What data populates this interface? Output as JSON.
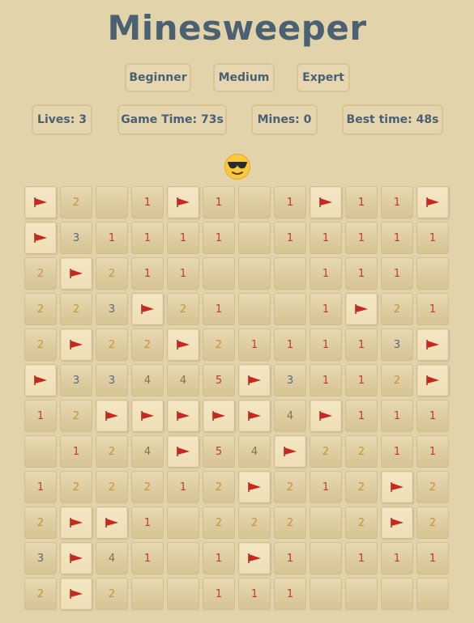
{
  "title": "Minesweeper",
  "difficulty": {
    "beginner": "Beginner",
    "medium": "Medium",
    "expert": "Expert"
  },
  "stats": {
    "lives": "Lives: 3",
    "game_time": "Game Time: 73s",
    "mines": "Mines: 0",
    "best_time": "Best time: 48s"
  },
  "face_icon": "sunglasses-face-icon",
  "colors": {
    "background": "#e3d3aa",
    "title": "#4a6173",
    "flag": "#c5281c"
  },
  "board": [
    [
      "F",
      "2",
      "",
      "1",
      "F",
      "1",
      "",
      "1",
      "F",
      "1",
      "1",
      "F"
    ],
    [
      "F",
      "3",
      "1",
      "1",
      "1",
      "1",
      "",
      "1",
      "1",
      "1",
      "1",
      "1"
    ],
    [
      "2",
      "F",
      "2",
      "1",
      "1",
      "",
      "",
      "",
      "1",
      "1",
      "1",
      ""
    ],
    [
      "2",
      "2",
      "3",
      "F",
      "2",
      "1",
      "",
      "",
      "1",
      "F",
      "2",
      "1"
    ],
    [
      "2",
      "F",
      "2",
      "2",
      "F",
      "2",
      "1",
      "1",
      "1",
      "1",
      "3",
      "F"
    ],
    [
      "F",
      "3",
      "3",
      "4",
      "4",
      "5",
      "F",
      "3",
      "1",
      "1",
      "2",
      "F"
    ],
    [
      "1",
      "2",
      "F",
      "F",
      "F",
      "F",
      "F",
      "4",
      "F",
      "1",
      "1",
      "1"
    ],
    [
      "",
      "1",
      "2",
      "4",
      "F",
      "5",
      "4",
      "F",
      "2",
      "2",
      "1",
      "1"
    ],
    [
      "1",
      "2",
      "2",
      "2",
      "1",
      "2",
      "F",
      "2",
      "1",
      "2",
      "F",
      "2"
    ],
    [
      "2",
      "F",
      "F",
      "1",
      "",
      "2",
      "2",
      "2",
      "",
      "2",
      "F",
      "2"
    ],
    [
      "3",
      "F",
      "4",
      "1",
      "",
      "1",
      "F",
      "1",
      "",
      "1",
      "1",
      "1"
    ],
    [
      "2",
      "F",
      "2",
      "",
      "",
      "1",
      "1",
      "1",
      "",
      "",
      "",
      ""
    ]
  ]
}
